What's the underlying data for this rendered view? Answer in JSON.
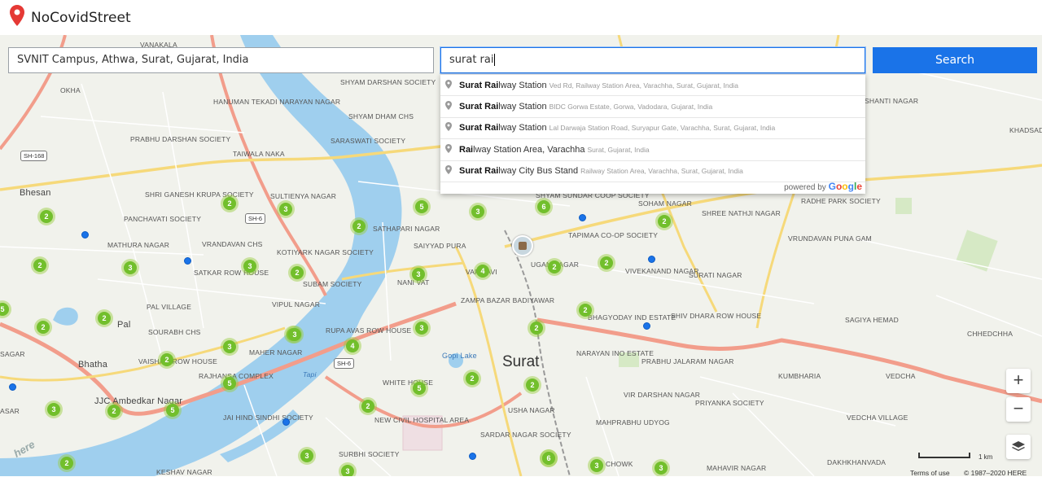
{
  "app": {
    "title": "NoCovidStreet",
    "brand_color": "#e53935"
  },
  "origin_input": {
    "value": "SVNIT Campus, Athwa, Surat, Gujarat, India"
  },
  "destination_input": {
    "value": "surat rai"
  },
  "search_button": {
    "label": "Search",
    "color": "#1a73e8"
  },
  "suggestions": [
    {
      "match": "Surat Rai",
      "rest": "lway Station",
      "secondary": "Ved Rd, Railway Station Area, Varachha, Surat, Gujarat, India"
    },
    {
      "match": "Surat Rai",
      "rest": "lway Station",
      "secondary": "BIDC Gorwa Estate, Gorwa, Vadodara, Gujarat, India"
    },
    {
      "match": "Surat Rai",
      "rest": "lway Station",
      "secondary": "Lal Darwaja Station Road, Suryapur Gate, Varachha, Surat, Gujarat, India"
    },
    {
      "match": "Rai",
      "rest": "lway Station Area, Varachha",
      "secondary": "Surat, Gujarat, India"
    },
    {
      "match": "Surat Rai",
      "rest": "lway City Bus Stand",
      "secondary": "Railway Station Area, Varachha, Surat, Gujarat, India"
    }
  ],
  "powered_by": {
    "text": "powered by",
    "brand": "Google"
  },
  "map": {
    "city_label": "Surat",
    "lake_label": "Gopi Lake",
    "river_label": "Tapi",
    "road_shields": [
      "SH-168",
      "SH-6",
      "SH-6"
    ],
    "places": [
      "VANAKALA",
      "OKHA",
      "HANUMAN TEKADI NARAYAN NAGAR",
      "SHYAM DARSHAN SOCIETY",
      "SHYAM DHAM CHS",
      "SARASWATI SOCIETY",
      "PRABHU DARSHAN SOCIETY",
      "TAIWALA NAKA",
      "Bhesan",
      "SHRI GANESH KRUPA SOCIETY",
      "SULTIENYA NAGAR",
      "PANCHAVATI SOCIETY",
      "MATHURA NAGAR",
      "VRANDAVAN CHS",
      "KOTIYARK NAGAR SOCIETY",
      "SATKAR ROW HOUSE",
      "SUBAM SOCIETY",
      "NANI VAT",
      "SATHAPARI NAGAR",
      "SAIYYAD PURA",
      "PAL VILLAGE",
      "Pal",
      "VIPUL NAGAR",
      "SOURABH CHS",
      "RUPA AVAS ROW HOUSE",
      "MAHER NAGAR",
      "ZAMPA BAZAR BADIYAWAR",
      "Bhatha",
      "VAISHALI ROW HOUSE",
      "RAJHANSA COMPLEX",
      "WHITE HOUSE",
      "JJC Ambedkar Nagar",
      "JAI HIND SINDHI SOCIETY",
      "NEW CIVIL HOSPITAL AREA",
      "USHA NAGAR",
      "SARDAR NAGAR SOCIETY",
      "SURBHI SOCIETY",
      "KESHAV NAGAR",
      "SHYAM SUNDAR COOP SOCIETY",
      "TAPIMAA CO-OP SOCIETY",
      "SOHAM NAGAR",
      "SHREE NATHJI NAGAR",
      "RADHE PARK SOCIETY",
      "VRUNDAVAN PUNA GAM",
      "VIVEKANAND NAGAR",
      "SURATI NAGAR",
      "UGAN NAGAR",
      "VARIYAVI",
      "BHAGYODAY IND ESTATE",
      "SHIV DHARA ROW HOUSE",
      "NARAYAN INO ESTATE",
      "PRABHU JALARAM NAGAR",
      "VIR DARSHAN NAGAR",
      "MAHPRABHU UDYOG",
      "PRIYANKA SOCIETY",
      "KUMBHARIA",
      "VEDCHA",
      "VEDCHA VILLAGE",
      "SAGIYA HEMAD",
      "CHHEDCHHA",
      "SHANTI NAGAR",
      "KHADSAD",
      "DAKHKHANVADA",
      "MAHAVIR NAGAR",
      "CHOWK",
      "ASAR",
      "SAGAR"
    ],
    "clusters": [
      "2",
      "2",
      "2",
      "3",
      "3",
      "3",
      "2",
      "2",
      "5",
      "3",
      "6",
      "2",
      "2",
      "4",
      "3",
      "2",
      "2",
      "2",
      "3",
      "3",
      "3",
      "2",
      "4",
      "2",
      "5",
      "2",
      "5",
      "2",
      "6",
      "2",
      "3",
      "5",
      "2",
      "3",
      "3",
      "6",
      "3",
      "3",
      "2",
      "2",
      "5",
      "3"
    ]
  },
  "controls": {
    "zoom_in": "+",
    "zoom_out": "−"
  },
  "scale_label": "1 km",
  "footer": {
    "terms": "Terms of use",
    "copyright": "© 1987–2020 HERE"
  },
  "here_logo": "here"
}
